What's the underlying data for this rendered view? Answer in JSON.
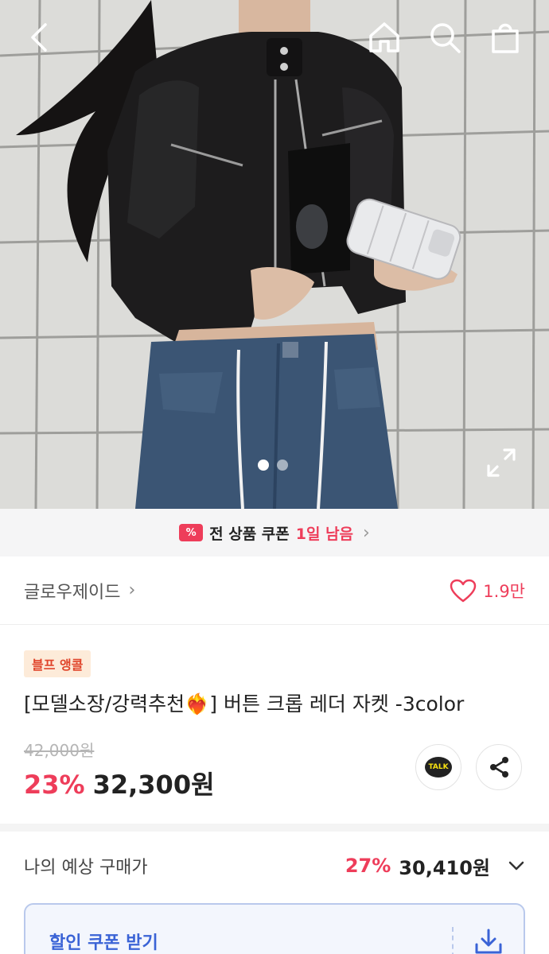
{
  "header": {
    "icons": [
      "back-icon",
      "home-icon",
      "search-icon",
      "shopping-bag-icon"
    ]
  },
  "gallery": {
    "image_count": 2,
    "active_index": 0,
    "expand_icon": "expand-icon"
  },
  "coupon_banner": {
    "icon": "coupon-icon",
    "text": "전 상품 쿠폰",
    "highlight": "1일 남음",
    "chevron": "›"
  },
  "brand": {
    "name": "글로우제이드",
    "chevron": "›",
    "like_count": "1.9만"
  },
  "product": {
    "badge": "블프 앵콜",
    "title": "[모델소장/강력추천❤️‍🔥] 버튼 크롭 레더 자켓 -3color",
    "original_price": "42,000원",
    "discount": "23%",
    "price": "32,300원",
    "kakao_label": "TALK"
  },
  "expected_price": {
    "label": "나의 예상 구매가",
    "discount": "27%",
    "amount": "30,410원"
  },
  "coupon_download": {
    "label": "할인 쿠폰 받기"
  },
  "colors": {
    "accent": "#ee3d5a",
    "coupon_blue": "#3a63d6",
    "badge_bg": "#fdebd9",
    "badge_text": "#e0452b"
  }
}
